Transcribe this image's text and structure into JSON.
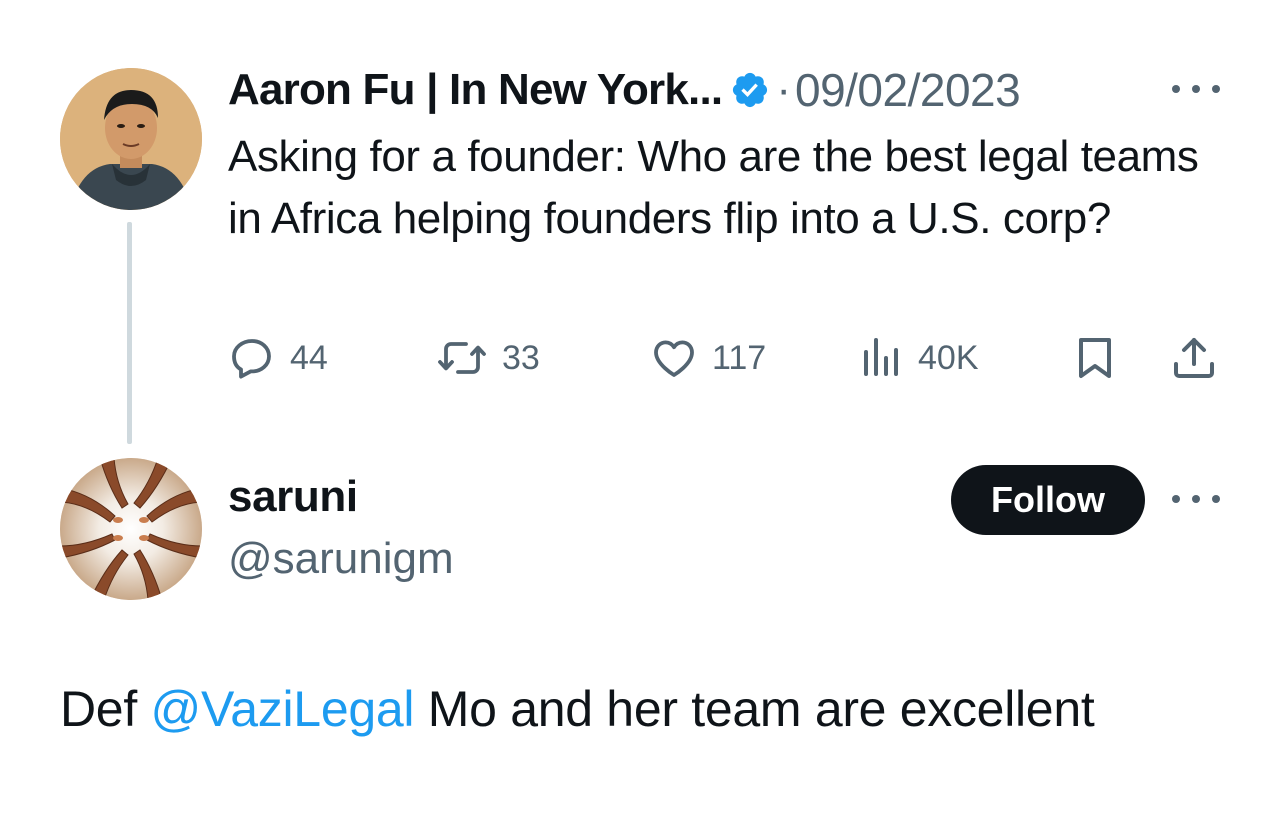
{
  "parent_tweet": {
    "display_name": "Aaron Fu | In New York...",
    "verified": true,
    "separator": "·",
    "timestamp": "09/02/2023",
    "text": "Asking for a founder: Who are the best legal teams in Africa helping founders flip into a U.S. corp?",
    "stats": {
      "replies": "44",
      "retweets": "33",
      "likes": "117",
      "views": "40K"
    },
    "icons": {
      "reply": "reply-icon",
      "retweet": "retweet-icon",
      "like": "heart-icon",
      "views": "views-icon",
      "bookmark": "bookmark-icon",
      "share": "share-icon",
      "more": "more-icon"
    }
  },
  "reply_tweet": {
    "display_name": "saruni",
    "handle": "@sarunigm",
    "follow_label": "Follow",
    "text_before": "Def ",
    "mention": "@VaziLegal",
    "text_after": " Mo and her team are excellent"
  },
  "colors": {
    "text": "#0f1419",
    "secondary": "#536471",
    "link": "#1d9bf0",
    "verified": "#1d9bf0",
    "follow_bg": "#0f1419",
    "thread_line": "#cfd9de"
  }
}
